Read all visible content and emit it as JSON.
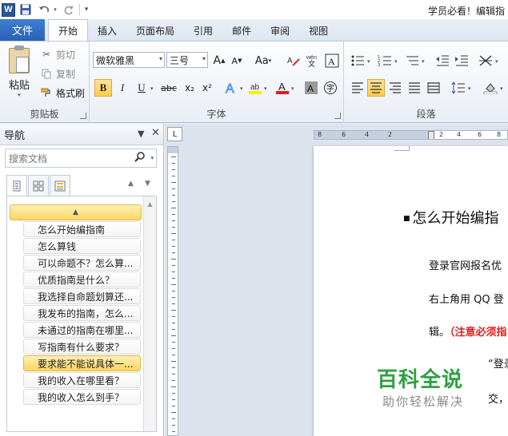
{
  "title_bar": {
    "logo": "W",
    "title": "学员必看！编辑指"
  },
  "ribbon": {
    "file_tab": "文件",
    "tabs": [
      "开始",
      "插入",
      "页面布局",
      "引用",
      "邮件",
      "审阅",
      "视图"
    ],
    "active_tab": "开始",
    "clipboard": {
      "paste": "粘贴",
      "cut": "剪切",
      "copy": "复制",
      "format_painter": "格式刷",
      "label": "剪贴板"
    },
    "font": {
      "name": "微软雅黑",
      "size": "三号",
      "label": "字体",
      "bold": "B",
      "italic": "I",
      "underline": "U",
      "strike": "abc",
      "subscript": "x₂",
      "superscript": "x²",
      "grow": "A",
      "shrink": "A",
      "case": "Aa",
      "highlight_color": "#ffef00",
      "font_color": "#e01d1d"
    },
    "paragraph": {
      "label": "段落"
    }
  },
  "nav": {
    "title": "导航",
    "search_placeholder": "搜索文档",
    "headings": [
      "怎么开始编指南",
      "怎么算钱",
      "可以命题不？怎么算...",
      "优质指南是什么？",
      "我选择自命题划算还...",
      "我发布的指南，怎么...",
      "未通过的指南在哪里...",
      "写指南有什么要求？",
      "要求能不能说具体一...",
      "我的收入在哪里看？",
      "我的收入怎么到手？"
    ],
    "current_heading_index": 8
  },
  "document": {
    "ruler_corner": "L",
    "ruler_numbers": [
      "8",
      "6",
      "4",
      "2",
      "2",
      "4",
      "6",
      "8"
    ],
    "heading": "怎么开始编指",
    "paragraphs": [
      "登录官网报名优",
      "右上角用 QQ 登",
      "“登录",
      "交，"
    ],
    "red_line_prefix": "辑。",
    "red_line_note": "（注意必须指"
  },
  "watermark": {
    "main": "百科全说",
    "sub": "助你轻松解决"
  }
}
